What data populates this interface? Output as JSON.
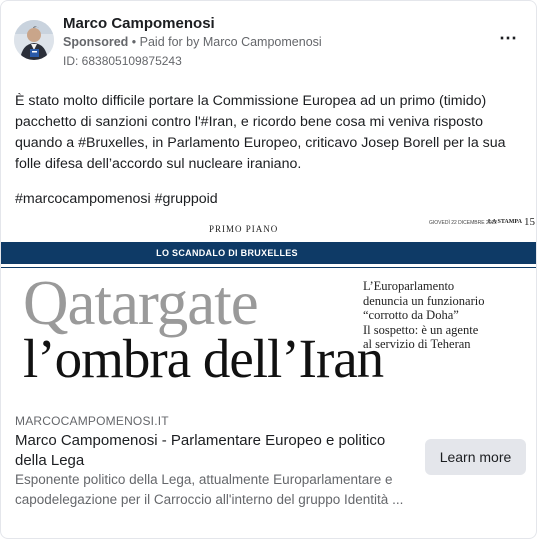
{
  "post": {
    "author": "Marco Campomenosi",
    "sponsored": "Sponsored",
    "paid_for_prefix": "• Paid for by",
    "paid_for_by": "Marco Campomenosi",
    "ad_id": "ID: 683805109875243",
    "more_icon": "⋯",
    "text": "È stato molto difficile portare la Commissione Europea ad un primo (timido) pacchetto di sanzioni contro l'#Iran, e ricordo bene cosa mi veniva risposto quando a #Bruxelles, in Parlamento Europeo, criticavo Josep Borell per la sua folle difesa dell’accordo sul nucleare iraniano.",
    "hashtags": "#marcocampomenosi #gruppoid"
  },
  "creative": {
    "section": "PRIMO PIANO",
    "date": "GIOVEDÌ 22 DICEMBRE 2022",
    "paper": "LA STAMPA",
    "page": "15",
    "bar_label": "LO SCANDALO DI BRUXELLES",
    "headline_1": "Qatargate",
    "headline_2": "l’ombra dell’Iran",
    "sidebar_lines": [
      "L’Europarlamento",
      "denuncia un funzionario",
      "“corrotto da Doha”",
      "Il sospetto: è un agente",
      "al servizio di Teheran"
    ]
  },
  "link": {
    "domain": "MARCOCAMPOMENOSI.IT",
    "title": "Marco Campomenosi - Parlamentare Europeo e politico della Lega",
    "description": "Esponente politico della Lega, attualmente Europarlamentare e capodelegazione per il Carroccio all'interno del gruppo Identità ...",
    "cta": "Learn more"
  },
  "colors": {
    "bar": "#0e3a66",
    "headline_grey": "#9a9a9a",
    "button_bg": "#e4e6eb",
    "secondary_text": "#65676b"
  }
}
